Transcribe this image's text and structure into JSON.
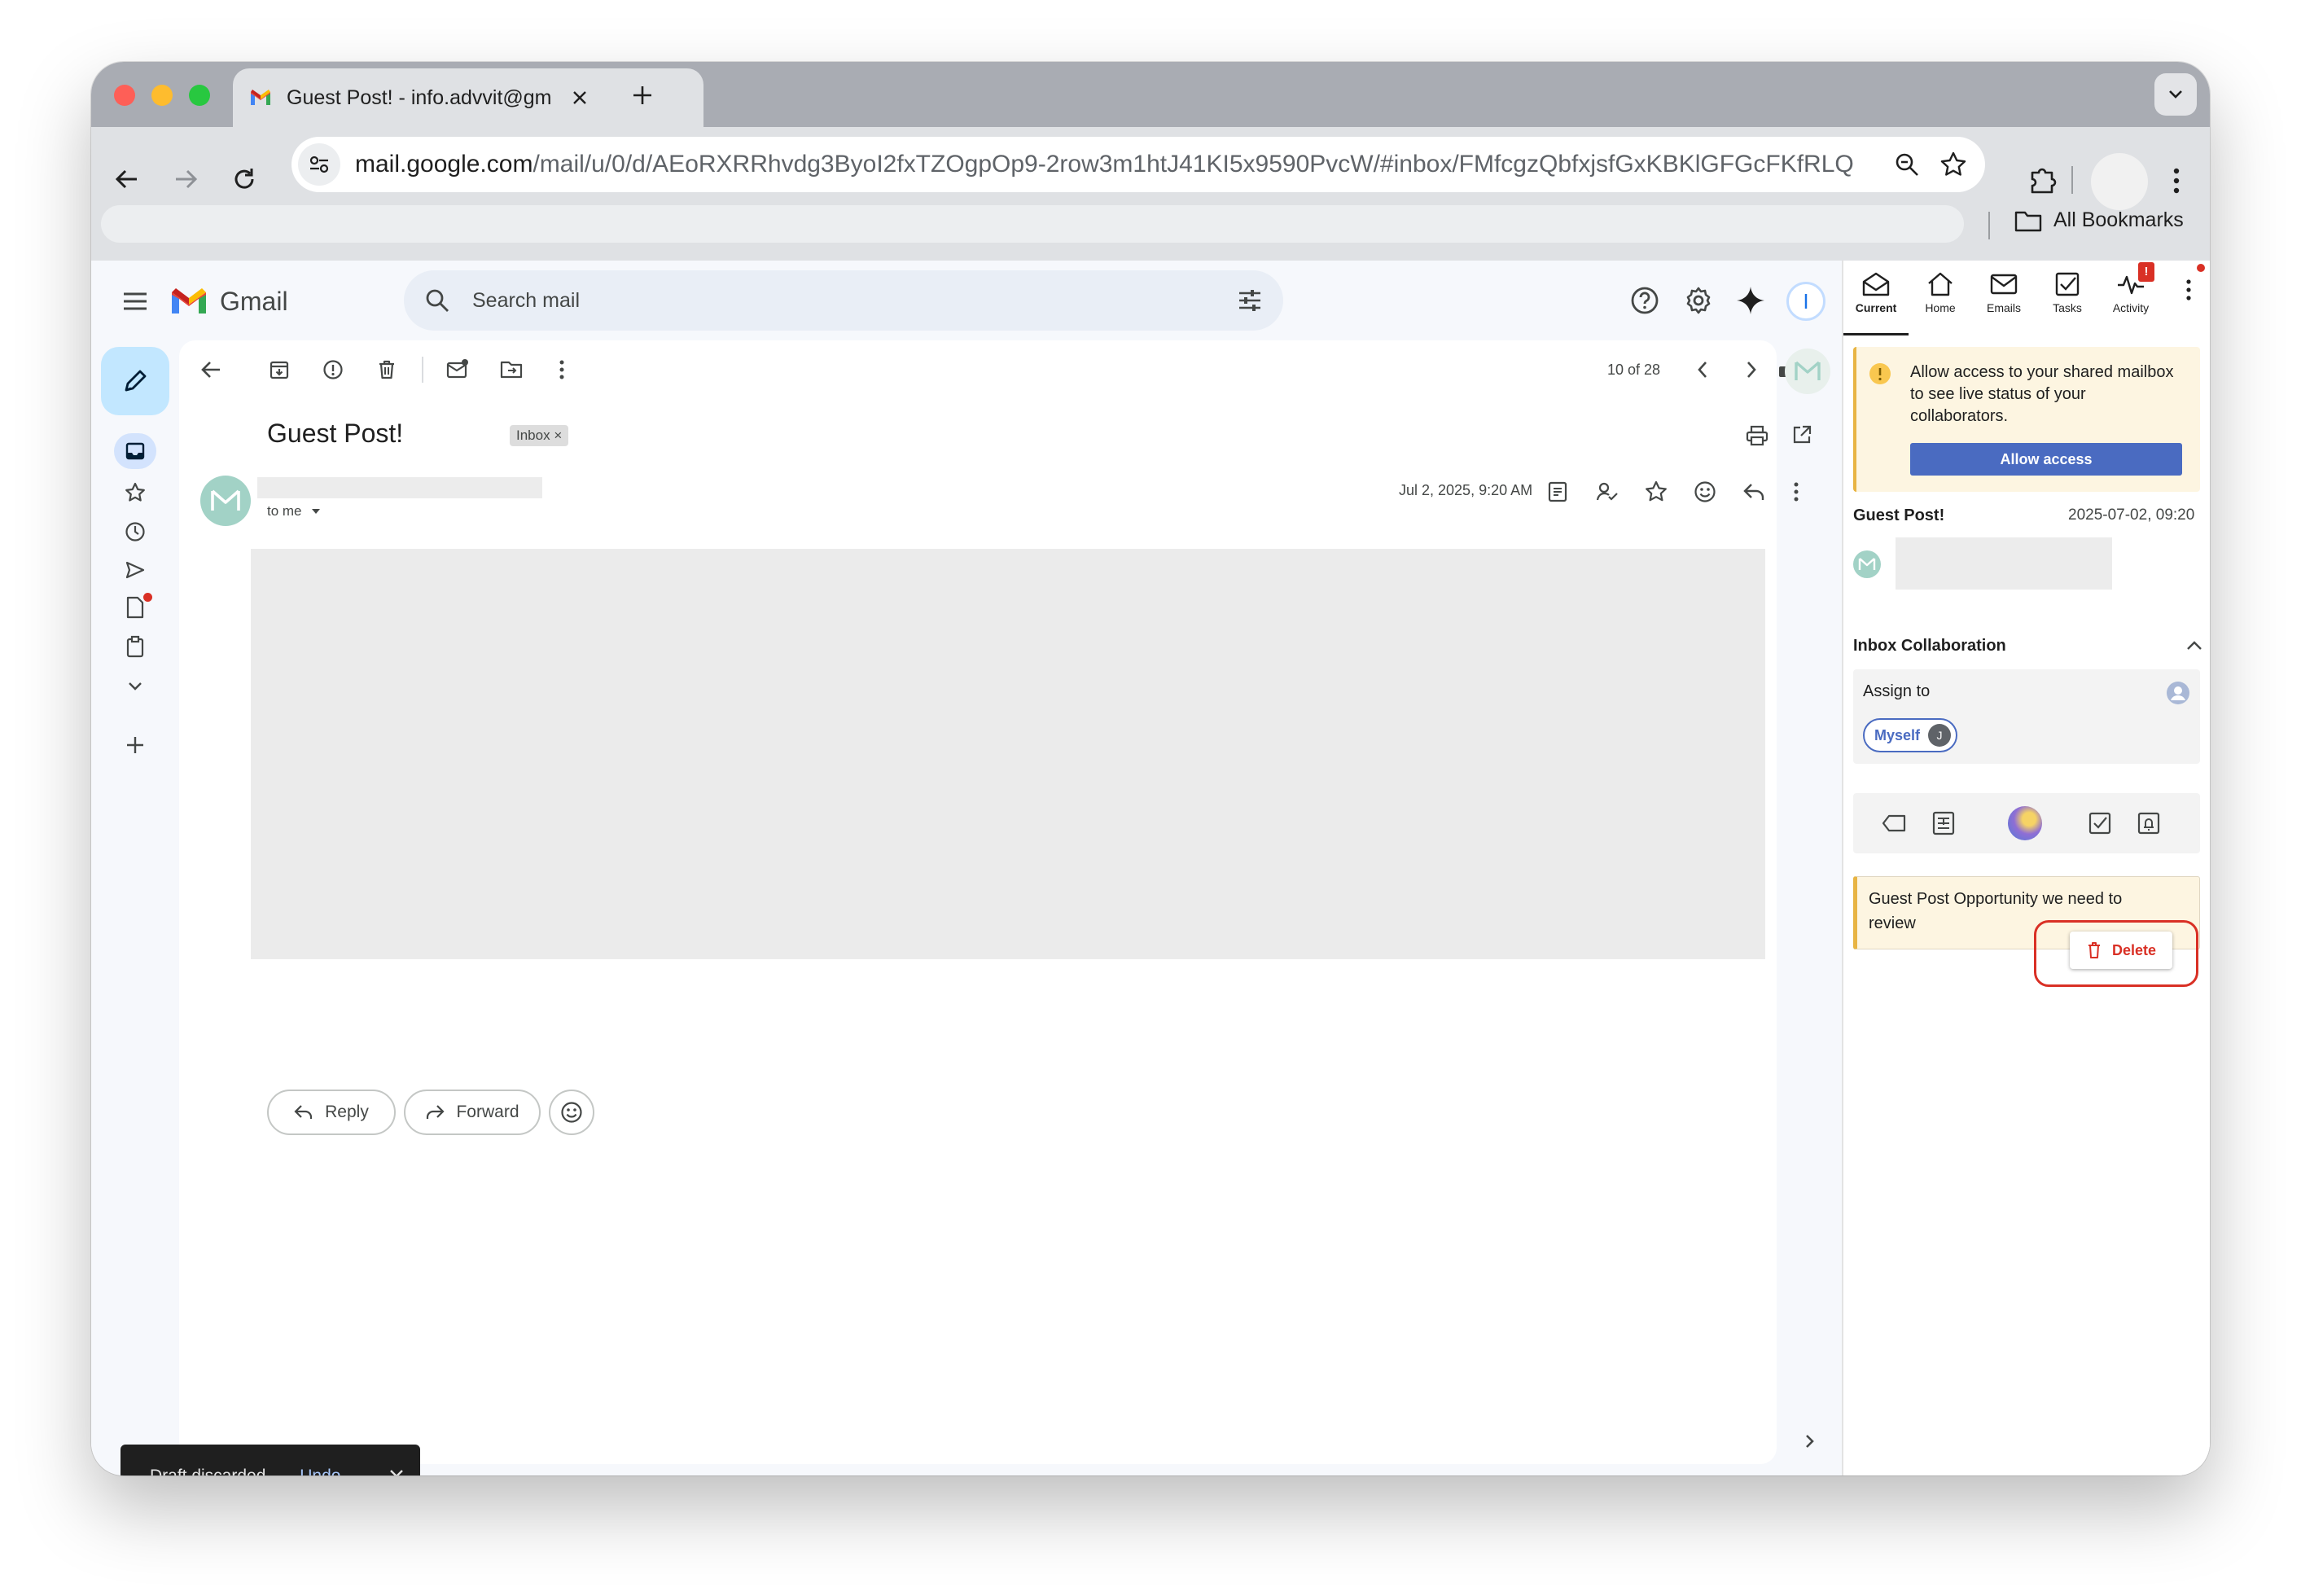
{
  "browser": {
    "tab_title": "Guest Post! - info.advvit@gm",
    "url_host": "mail.google.com",
    "url_path": "/mail/u/0/d/AEoRXRRhvdg3ByoI2fxTZOgpOp9-2row3m1htJ41KI5x9590PvcW/#inbox/FMfcgzQbfxjsfGxKBKlGFGcFKfRLQZld",
    "bookmarks_label": "All Bookmarks"
  },
  "gmail": {
    "logo_text": "Gmail",
    "search_placeholder": "Search mail",
    "pagination": "10 of 28",
    "subject": "Guest Post!",
    "label_chip": "Inbox",
    "date": "Jul 2, 2025, 9:20 AM",
    "to_me": "to me",
    "reply_label": "Reply",
    "forward_label": "Forward",
    "avatar_letter": "I"
  },
  "snackbar": {
    "message": "Draft discarded.",
    "undo": "Undo"
  },
  "sidepanel": {
    "tabs": [
      {
        "label": "Current",
        "icon": "mail-open-icon"
      },
      {
        "label": "Home",
        "icon": "home-icon"
      },
      {
        "label": "Emails",
        "icon": "envelope-icon"
      },
      {
        "label": "Tasks",
        "icon": "checkbox-icon"
      },
      {
        "label": "Activity",
        "icon": "pulse-icon"
      }
    ],
    "activity_badge": "!",
    "alert_text": "Allow access to your shared mailbox to see live status of your collaborators.",
    "allow_button": "Allow access",
    "email_subject": "Guest Post!",
    "email_date": "2025-07-02, 09:20",
    "collab_title": "Inbox Collaboration",
    "assign_label": "Assign to",
    "assignee": "Myself",
    "assignee_initial": "J",
    "note_text": "Guest Post Opportunity we need to review",
    "delete_label": "Delete"
  },
  "colors": {
    "accent_blue": "#4a6bc1",
    "delete_red": "#d93025",
    "alert_bg": "#fdf5e1",
    "note_border": "#e8b443"
  }
}
